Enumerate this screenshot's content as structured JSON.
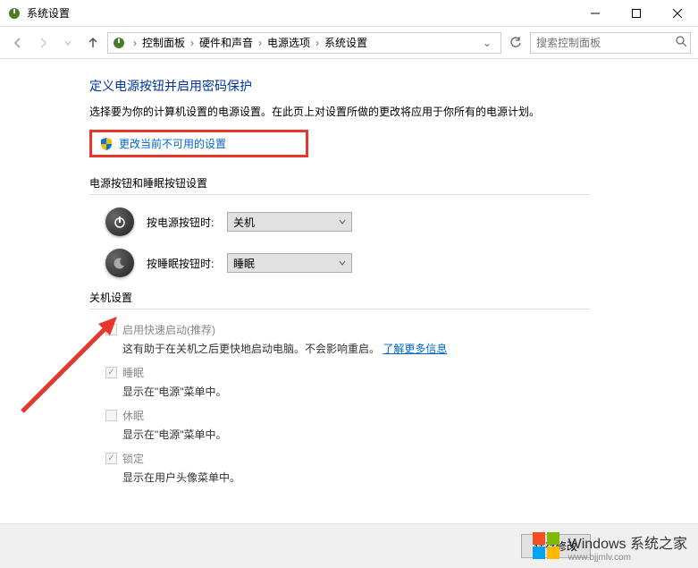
{
  "window": {
    "title": "系统设置"
  },
  "breadcrumb": {
    "items": [
      "控制面板",
      "硬件和声音",
      "电源选项",
      "系统设置"
    ]
  },
  "search": {
    "placeholder": "搜索控制面板"
  },
  "page": {
    "title": "定义电源按钮并启用密码保护",
    "description": "选择要为你的计算机设置的电源设置。在此页上对设置所做的更改将应用于你所有的电源计划。",
    "change_settings_link": "更改当前不可用的设置"
  },
  "button_section": {
    "header": "电源按钮和睡眠按钮设置",
    "power_button": {
      "label": "按电源按钮时:",
      "value": "关机"
    },
    "sleep_button": {
      "label": "按睡眠按钮时:",
      "value": "睡眠"
    }
  },
  "shutdown_section": {
    "header": "关机设置",
    "items": [
      {
        "label": "启用快速启动(推荐)",
        "description": "这有助于在关机之后更快地启动电脑。不会影响重启。",
        "learn_more": "了解更多信息",
        "checked": true,
        "disabled": true
      },
      {
        "label": "睡眠",
        "description": "显示在\"电源\"菜单中。",
        "checked": true,
        "disabled": true
      },
      {
        "label": "休眠",
        "description": "显示在\"电源\"菜单中。",
        "checked": false,
        "disabled": true
      },
      {
        "label": "锁定",
        "description": "显示在用户头像菜单中。",
        "checked": true,
        "disabled": true
      }
    ]
  },
  "footer": {
    "save_button": "保存修改"
  },
  "watermark": {
    "brand": "Windows",
    "subtitle": "系统之家",
    "url": "www.bjjmlv.com"
  }
}
